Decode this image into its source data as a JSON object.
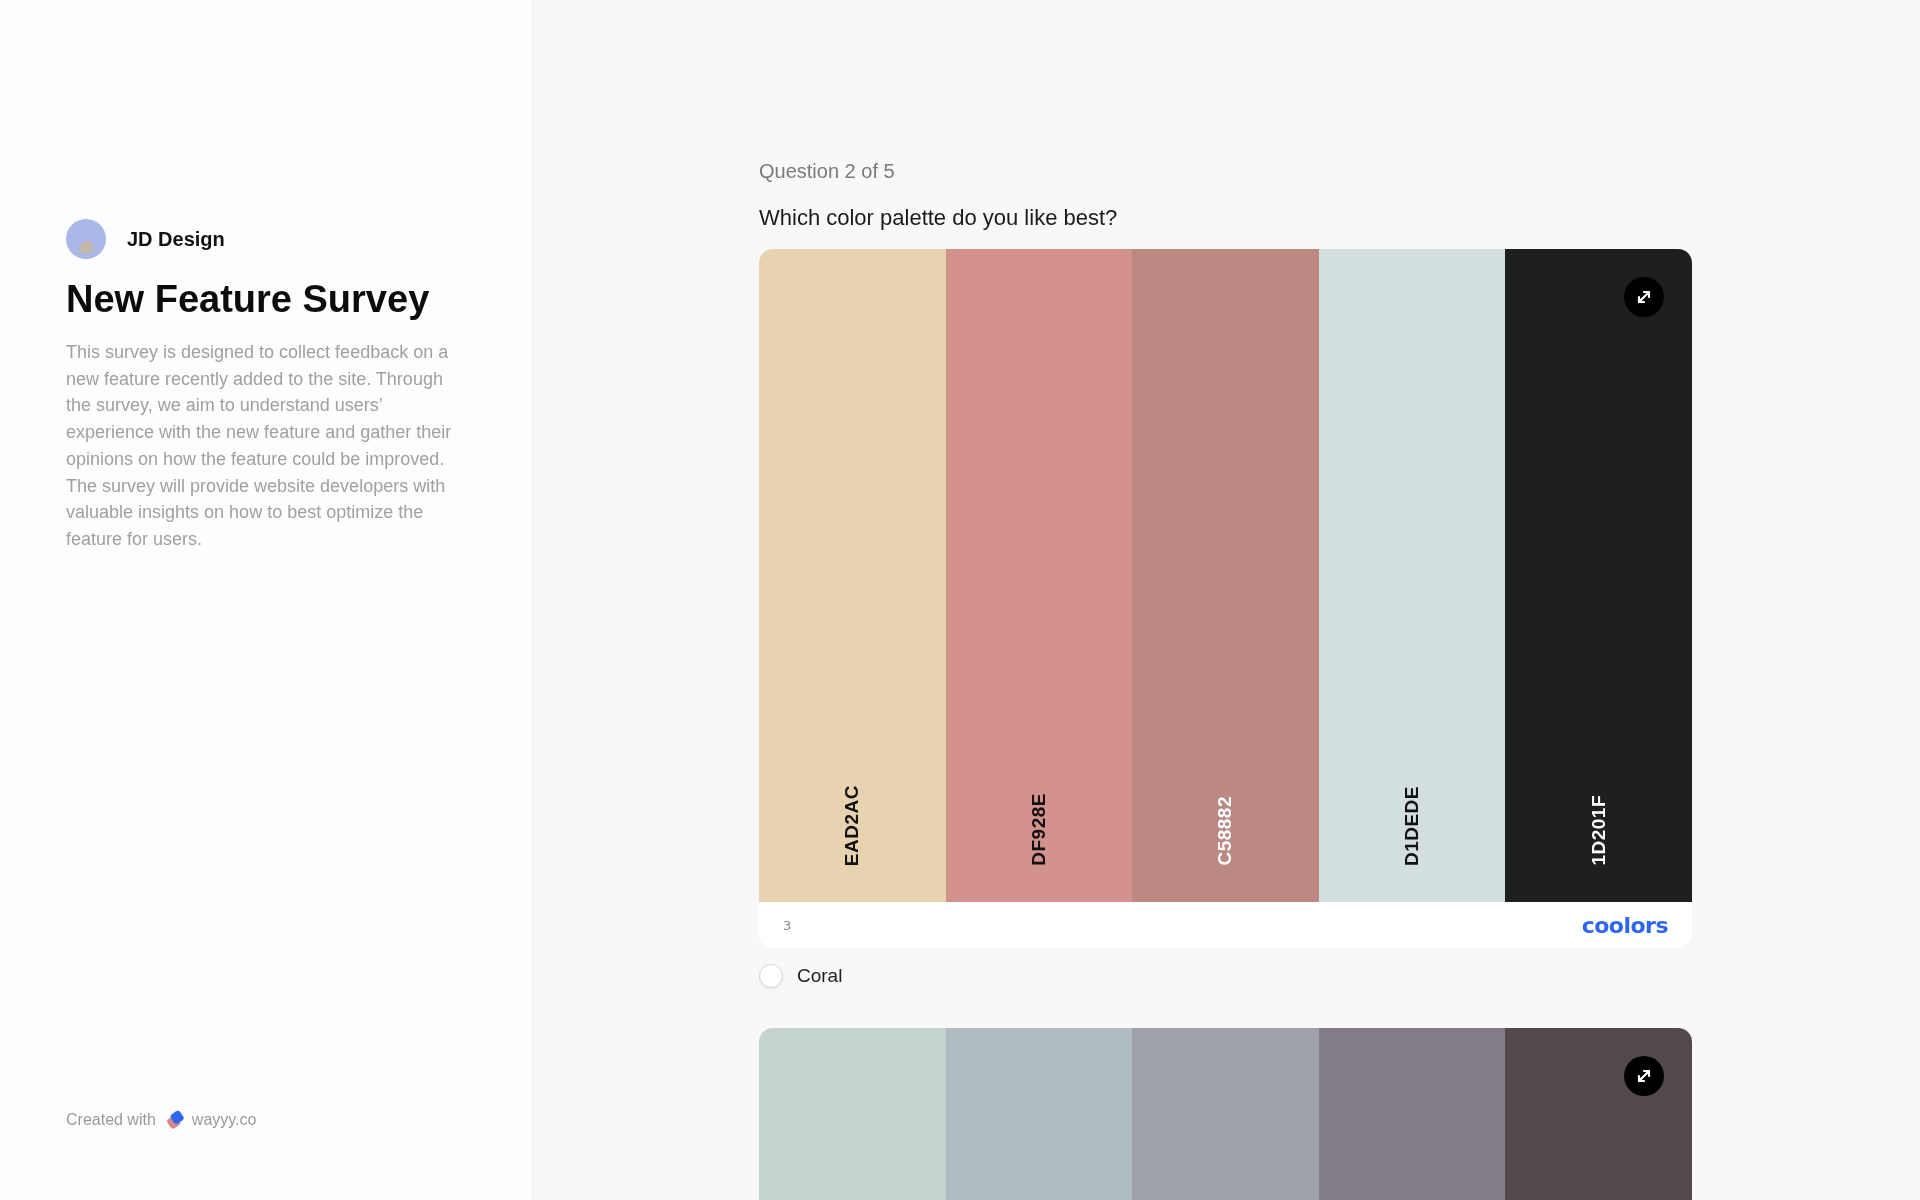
{
  "creator": {
    "name": "JD Design"
  },
  "survey": {
    "title": "New Feature Survey",
    "description": "This survey is designed to collect feedback on a new feature recently added to the site. Through the survey, we aim to understand users’ experience with the new feature and gather their opinions on how the feature could be improved. The survey will provide website developers with valuable insights on how to best optimize the feature for users."
  },
  "footer": {
    "created_with": "Created with",
    "brand": "wayyy.co"
  },
  "question": {
    "progress": "Question 2 of 5",
    "prompt": "Which color palette do you like best?"
  },
  "options": [
    {
      "swatches": [
        {
          "label": "EAD2AC",
          "color": "#e8d3b0"
        },
        {
          "label": "DF928E",
          "color": "#d4928e"
        },
        {
          "label": "C58882",
          "color": "#bb8882"
        },
        {
          "label": "D1DEDE",
          "color": "#d3dfdf"
        },
        {
          "label": "1D201F",
          "color": "#1d201f"
        }
      ],
      "number": "3",
      "logo": "coolors",
      "label": "Coral",
      "selected": false
    },
    {
      "swatches": [
        {
          "color": "#c5d3ce"
        },
        {
          "color": "#b0bcc1"
        },
        {
          "color": "#9ea1a8"
        },
        {
          "color": "#837c87"
        },
        {
          "color": "#52494c"
        }
      ]
    }
  ]
}
